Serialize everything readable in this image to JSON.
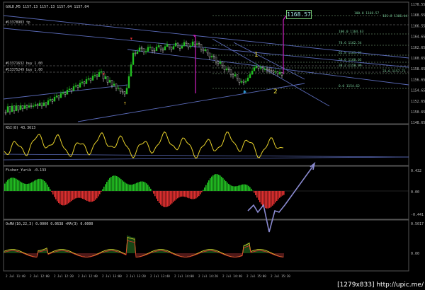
{
  "symbol_header": "GOLD,M5  1157.13 1157.13 1157.04 1157.04",
  "current_price_box": "1168.57",
  "wave_labels": [
    "1",
    "2"
  ],
  "order_labels": [
    "#13378983 tp",
    "#13371632 buy 1.00",
    "#13375249 buy 1.00"
  ],
  "fib_labels": [
    "100.0 1168.57",
    "161.8 1166.44",
    "100.0 1164.63",
    "78.6 1162.54",
    "61.8 1161.04",
    "50.0 1160.03",
    "38.2 1158.99",
    "23.6 1157.71",
    "0.0 1154.62"
  ],
  "price_axis": [
    "1170.55",
    "1168.55",
    "1166.55",
    "1164.65",
    "1162.65",
    "1160.65",
    "1158.65",
    "1156.65",
    "1154.65",
    "1152.65",
    "1150.65",
    "1148.65"
  ],
  "indicators": {
    "rsi": {
      "label": "RSI(8) 43.3613"
    },
    "fisher": {
      "label": "Fisher_Yurik -0.133",
      "top": "0.432",
      "zero": "0.00",
      "bottom": "-0.441"
    },
    "osma": {
      "label": "OsMA(10,22,3) 0.0000 0.0638  +MA(3) 0.0000",
      "top": "0.5017",
      "zero": "0.00"
    }
  },
  "time_axis": [
    "2 Jul 11:40",
    "2 Jul 12:00",
    "2 Jul 12:20",
    "2 Jul 12:40",
    "2 Jul 13:00",
    "2 Jul 13:20",
    "2 Jul 13:40",
    "2 Jul 14:00",
    "2 Jul 14:20",
    "2 Jul 14:40",
    "2 Jul 15:00",
    "2 Jul 15:20"
  ],
  "watermark": "[1279x833] http://upic.me/",
  "colors": {
    "bull": "#22c022",
    "bear": "#e03030",
    "rsi": "#e8d22a",
    "grid": "#3a3a3a",
    "magenta": "#d020c0",
    "trend": "#5a6ab8"
  }
}
